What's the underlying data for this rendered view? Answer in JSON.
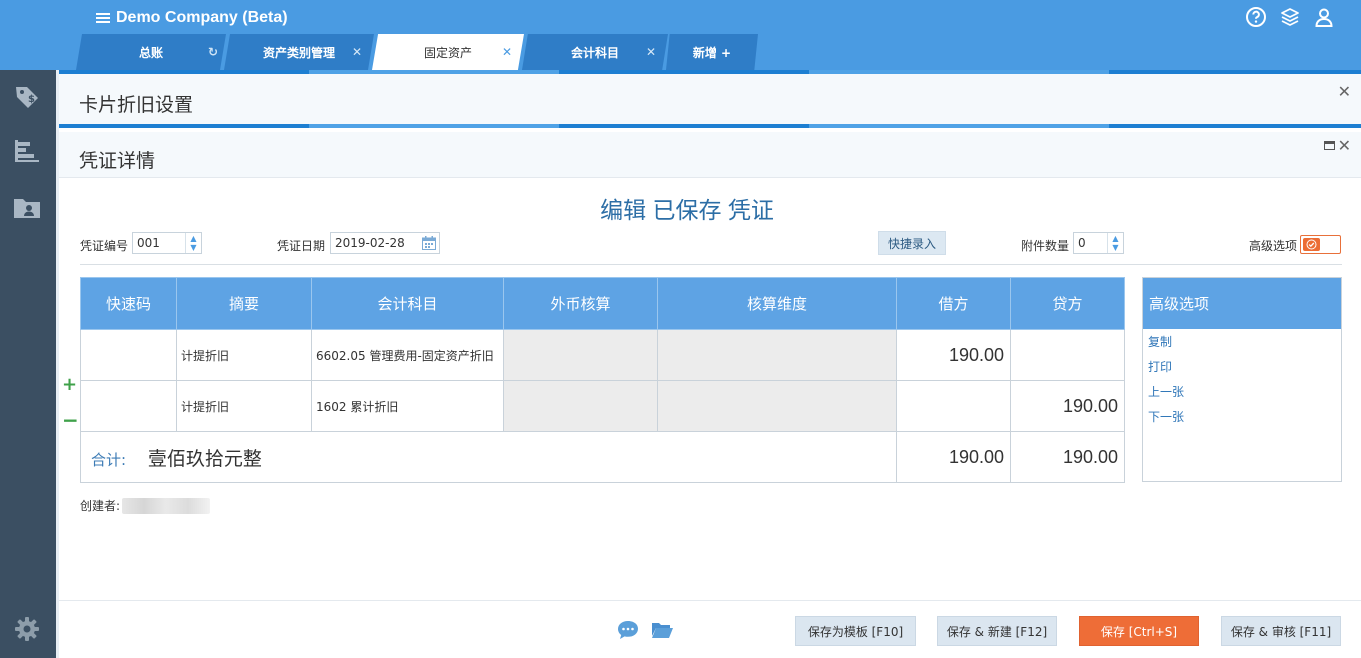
{
  "app": {
    "company": "Demo Company (Beta)",
    "icons": [
      "help-icon",
      "layers-icon",
      "user-icon"
    ]
  },
  "tabs": [
    {
      "label": "总账",
      "active": false,
      "closable": false,
      "refresh": true
    },
    {
      "label": "资产类别管理",
      "active": false,
      "closable": true
    },
    {
      "label": "固定资产",
      "active": true,
      "closable": true
    },
    {
      "label": "会计科目",
      "active": false,
      "closable": true
    },
    {
      "label": "新增  +",
      "active": false,
      "closable": false
    }
  ],
  "sidebar": {
    "items": [
      "tag-icon",
      "chart-bars-icon",
      "folder-user-icon"
    ],
    "bottom": "settings-gear-icon"
  },
  "panel_depreciation": {
    "title": "卡片折旧设置"
  },
  "panel_voucher": {
    "title": "凭证详情",
    "heading": "编辑 已保存 凭证",
    "voucher_no_label": "凭证编号",
    "voucher_no": "001",
    "voucher_date_label": "凭证日期",
    "voucher_date": "2019-02-28",
    "quick_entry": "快捷录入",
    "attachments_label": "附件数量",
    "attachments": "0",
    "advanced_label": "高级选项"
  },
  "table": {
    "headers": [
      "快速码",
      "摘要",
      "会计科目",
      "外币核算",
      "核算维度",
      "借方",
      "贷方"
    ],
    "rows": [
      {
        "code": "",
        "summary": "计提折旧",
        "account": "6602.05 管理费用-固定资产折旧",
        "debit": "190.00",
        "credit": ""
      },
      {
        "code": "",
        "summary": "计提折旧",
        "account": "1602 累计折旧",
        "debit": "",
        "credit": "190.00"
      }
    ],
    "total": {
      "label": "合计:",
      "amount_cn": "壹佰玖拾元整",
      "debit": "190.00",
      "credit": "190.00"
    },
    "add_row": "+",
    "remove_row": "−"
  },
  "advanced": {
    "title": "高级选项",
    "links": [
      "复制",
      "打印",
      "上一张",
      "下一张"
    ]
  },
  "creator_label": "创建者:",
  "footer": {
    "buttons": {
      "template": "保存为模板 [F10]",
      "save_new": "保存 & 新建 [F12]",
      "save": "保存 [Ctrl+S]",
      "save_audit": "保存 & 审核 [F11]"
    }
  },
  "colors": {
    "header": "#4a9be2",
    "sidebar": "#3b4f62",
    "table_header": "#5ea3e4",
    "primary_button": "#ee6d37",
    "link": "#2f76b8"
  }
}
